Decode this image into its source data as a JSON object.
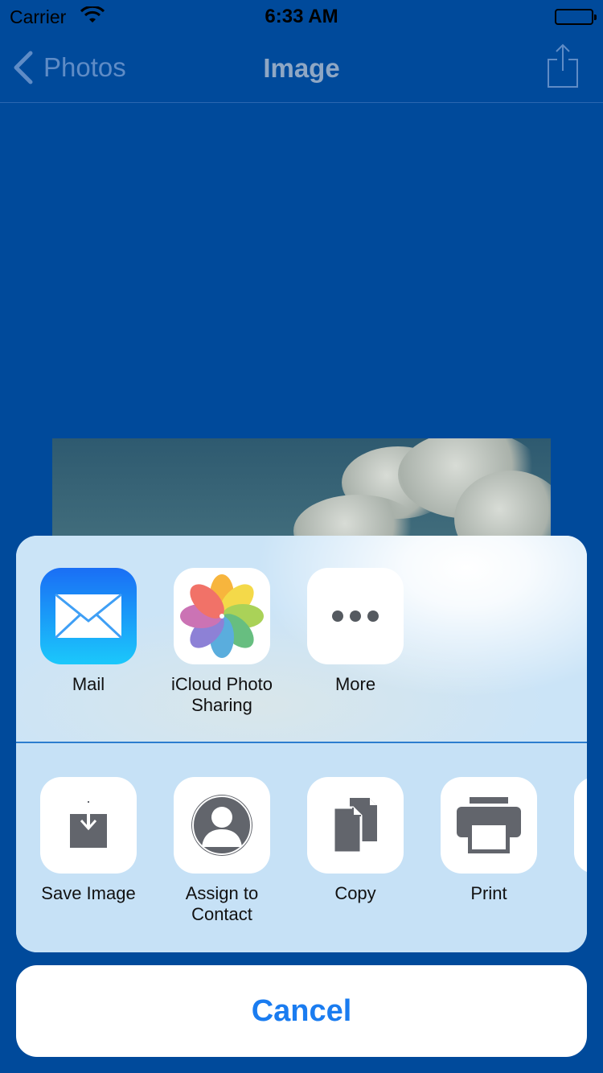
{
  "status_bar": {
    "carrier": "Carrier",
    "time": "6:33 AM"
  },
  "nav": {
    "back_label": "Photos",
    "title": "Image"
  },
  "share_sheet": {
    "app_row": [
      {
        "label": "Mail",
        "icon": "mail-icon"
      },
      {
        "label": "iCloud Photo Sharing",
        "icon": "photos-icon"
      },
      {
        "label": "More",
        "icon": "more-icon"
      }
    ],
    "action_row": [
      {
        "label": "Save Image",
        "icon": "save-image-icon"
      },
      {
        "label": "Assign to Contact",
        "icon": "contact-icon"
      },
      {
        "label": "Copy",
        "icon": "copy-icon"
      },
      {
        "label": "Print",
        "icon": "print-icon"
      }
    ],
    "cancel_label": "Cancel"
  },
  "colors": {
    "background": "#004a9b",
    "accent": "#1a7cf0",
    "sheet": "#c8e2f6"
  }
}
